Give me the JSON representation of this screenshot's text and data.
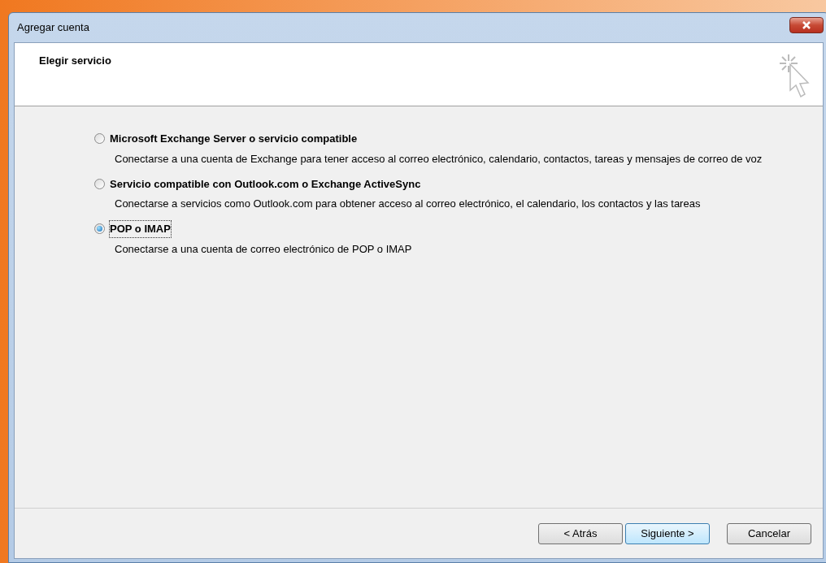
{
  "window": {
    "title": "Agregar cuenta"
  },
  "header": {
    "title": "Elegir servicio"
  },
  "options": [
    {
      "label": "Microsoft Exchange Server o servicio compatible",
      "description": "Conectarse a una cuenta de Exchange para tener acceso al correo electrónico, calendario, contactos, tareas y mensajes de correo de voz",
      "selected": false
    },
    {
      "label": "Servicio compatible con Outlook.com o Exchange ActiveSync",
      "description": "Conectarse a servicios como Outlook.com para obtener acceso al correo electrónico, el calendario, los contactos y las tareas",
      "selected": false
    },
    {
      "label": "POP o IMAP",
      "description": "Conectarse a una cuenta de correo electrónico de POP o IMAP",
      "selected": true
    }
  ],
  "buttons": [
    {
      "label": "< Atrás",
      "kind": "normal"
    },
    {
      "label": "Siguiente >",
      "kind": "default"
    },
    {
      "label": "Cancelar",
      "kind": "normal"
    }
  ]
}
